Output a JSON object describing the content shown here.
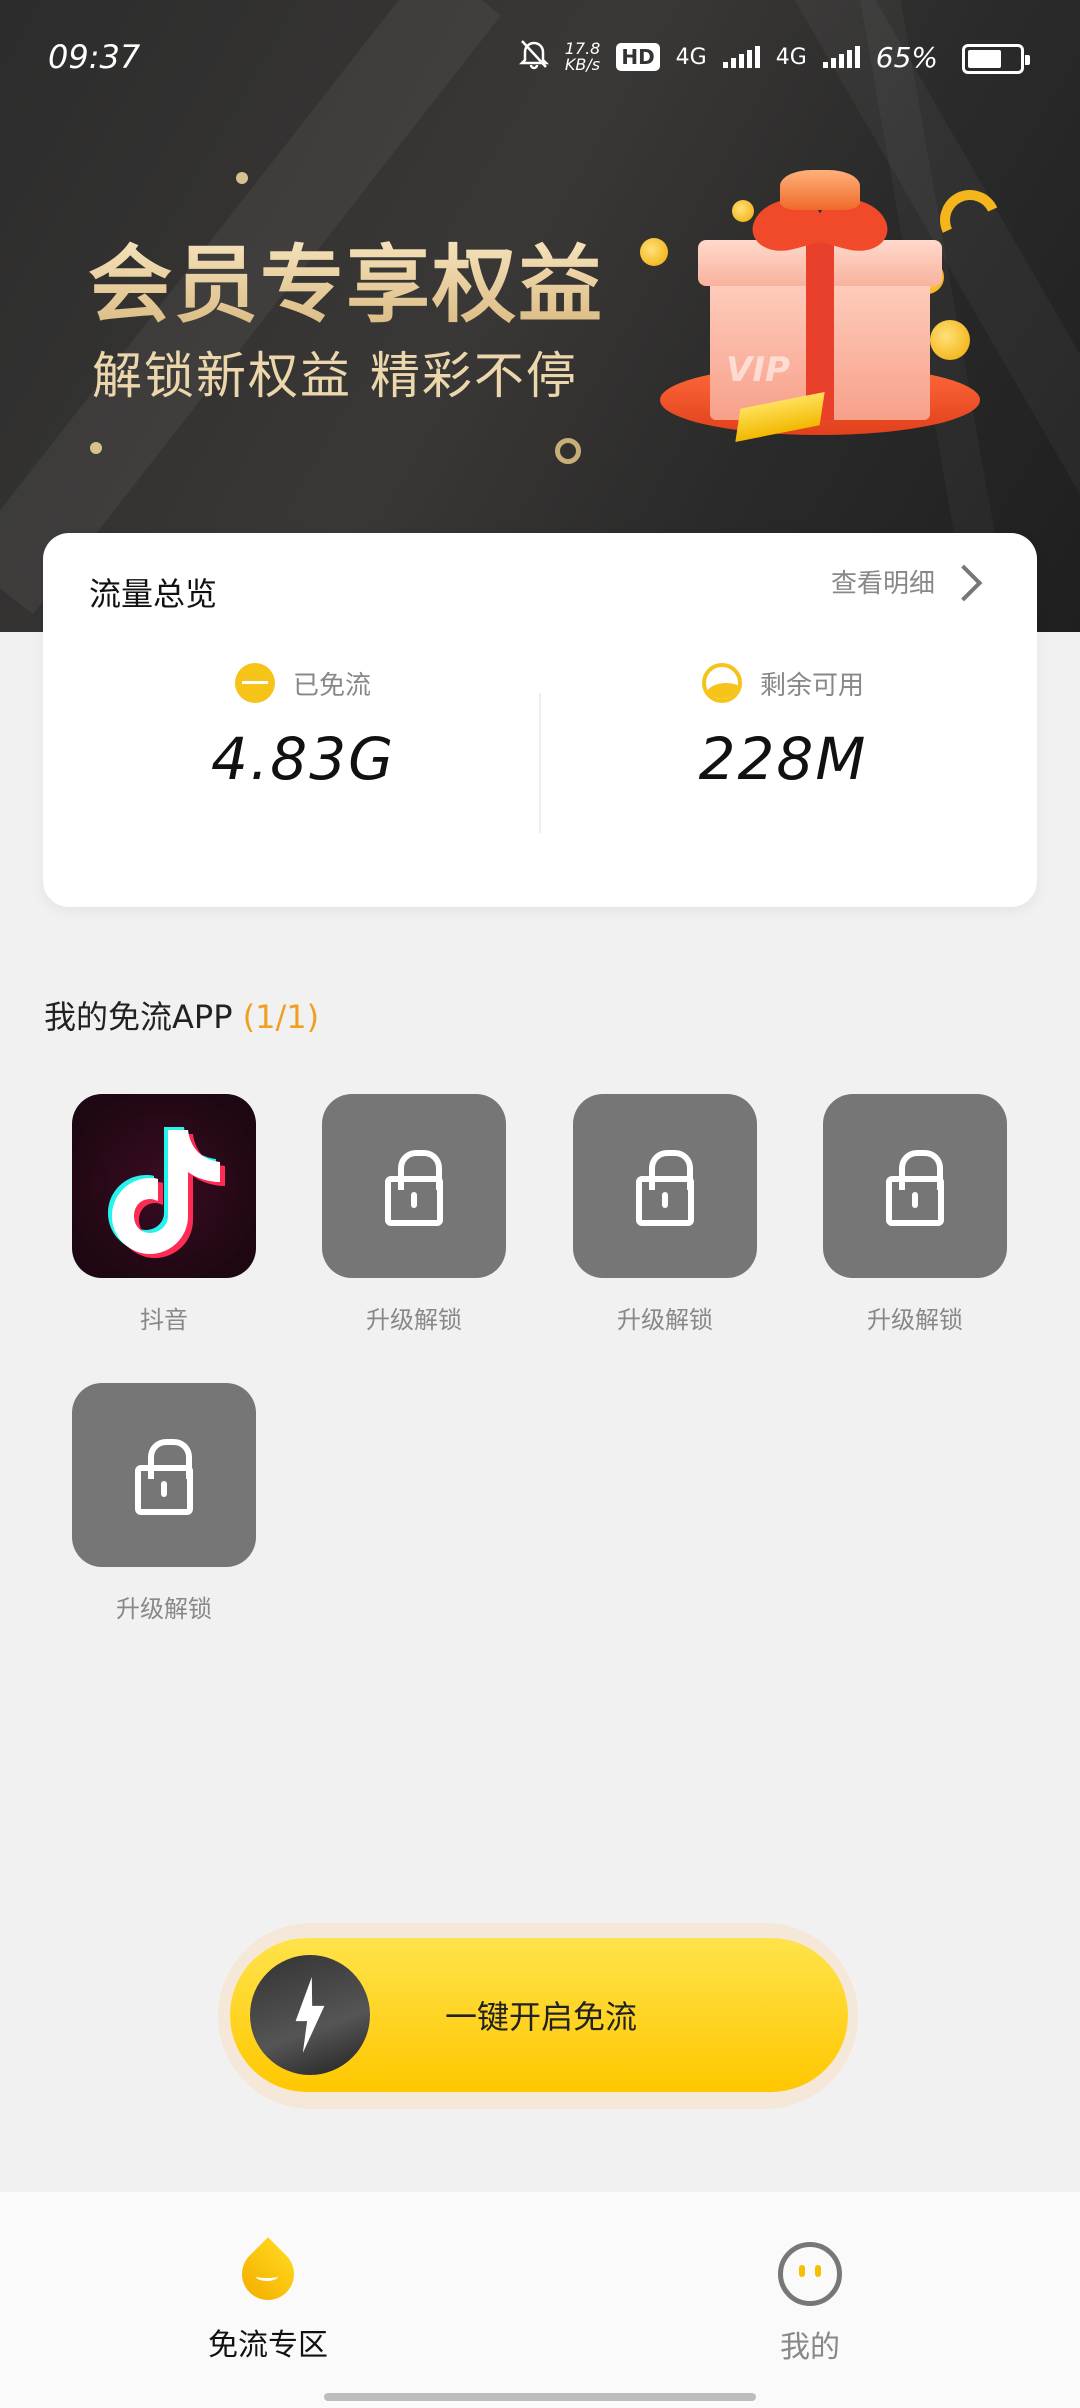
{
  "status_bar": {
    "time": "09:37",
    "net_speed_value": "17.8",
    "net_speed_unit": "KB/s",
    "hd_badge": "HD",
    "network_1": "4G",
    "network_2": "4G",
    "battery_percent": "65%",
    "battery_level": 0.65
  },
  "banner": {
    "title": "会员专享权益",
    "subtitle": "解锁新权益  精彩不停",
    "gift_label": "VIP"
  },
  "overview": {
    "title": "流量总览",
    "detail_link": "查看明细",
    "stats": [
      {
        "label": "已免流",
        "value": "4.83G"
      },
      {
        "label": "剩余可用",
        "value": "228M"
      }
    ]
  },
  "apps_section": {
    "title": "我的免流APP",
    "count": "(1/1)",
    "apps": [
      {
        "name": "抖音",
        "locked": false
      },
      {
        "name": "升级解锁",
        "locked": true
      },
      {
        "name": "升级解锁",
        "locked": true
      },
      {
        "name": "升级解锁",
        "locked": true
      },
      {
        "name": "升级解锁",
        "locked": true
      }
    ]
  },
  "cta": {
    "label": "一键开启免流"
  },
  "nav": {
    "items": [
      {
        "label": "免流专区",
        "active": true
      },
      {
        "label": "我的",
        "active": false
      }
    ]
  },
  "colors": {
    "accent_yellow": "#ffd000",
    "count_orange": "#f0a020",
    "locked_tile": "#767676"
  }
}
